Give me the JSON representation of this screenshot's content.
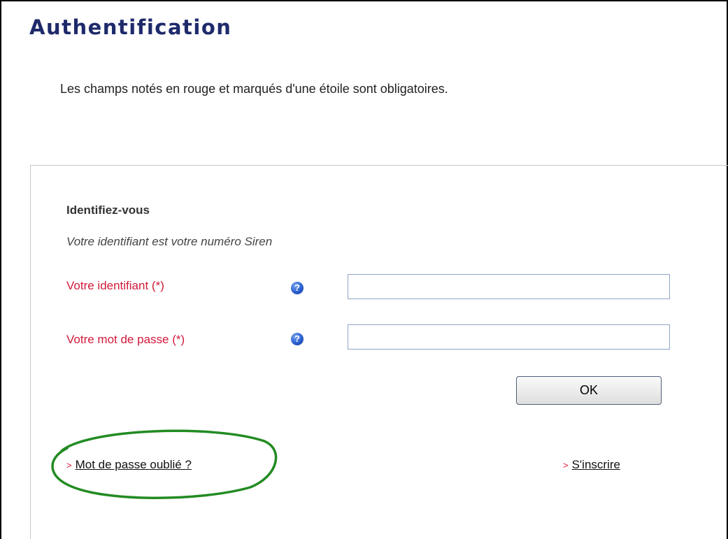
{
  "page": {
    "title": "Authentification",
    "intro": "Les champs notés en rouge et marqués d'une étoile sont obligatoires."
  },
  "form": {
    "section_title": "Identifiez-vous",
    "hint": "Votre identifiant est votre numéro Siren",
    "fields": [
      {
        "label": "Votre identifiant (*)",
        "value": "",
        "help_icon": "question-mark-icon"
      },
      {
        "label": "Votre mot de passe (*)",
        "value": "",
        "help_icon": "question-mark-icon"
      }
    ],
    "submit_label": "OK"
  },
  "links": {
    "arrow": ">",
    "forgot_password": "Mot de passe oublié ?",
    "register": "S'inscrire"
  },
  "annotation": {
    "shape": "ellipse",
    "color": "#228b22"
  },
  "colors": {
    "title": "#1f2a6b",
    "required_label": "#d01a3a",
    "help_icon": "#2a5fcf"
  }
}
